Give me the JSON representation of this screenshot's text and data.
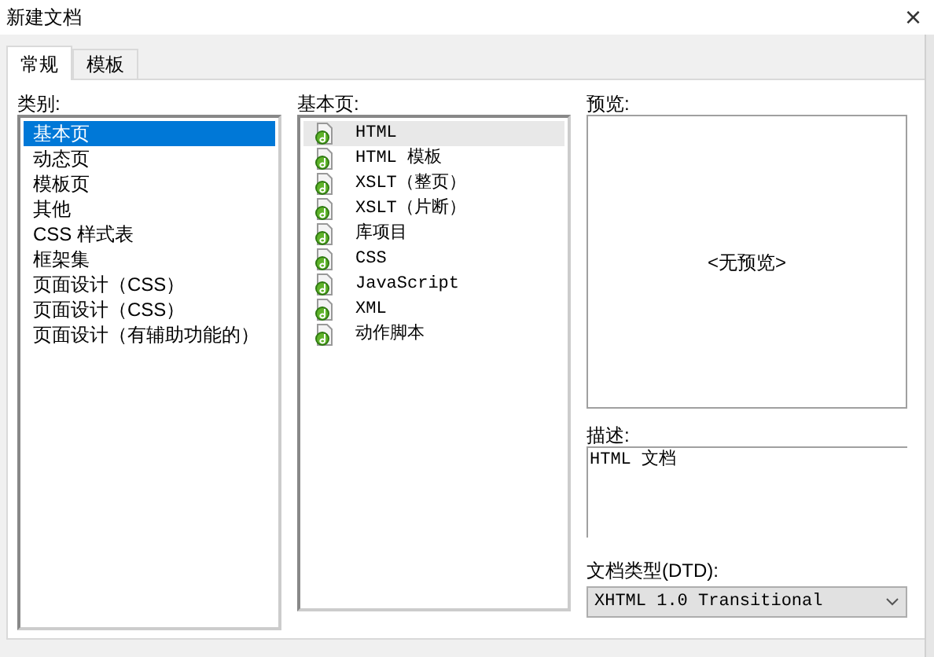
{
  "window": {
    "title": "新建文档",
    "close": "×"
  },
  "tabs": [
    {
      "label": "常规",
      "selected": true
    },
    {
      "label": "模板",
      "selected": false
    }
  ],
  "category": {
    "label": "类别:",
    "items": [
      {
        "label": "基本页",
        "selected": true
      },
      {
        "label": "动态页",
        "selected": false
      },
      {
        "label": "模板页",
        "selected": false
      },
      {
        "label": "其他",
        "selected": false
      },
      {
        "label": "CSS 样式表",
        "selected": false
      },
      {
        "label": "框架集",
        "selected": false
      },
      {
        "label": "页面设计（CSS）",
        "selected": false
      },
      {
        "label": "页面设计（CSS）",
        "selected": false
      },
      {
        "label": "页面设计（有辅助功能的）",
        "selected": false
      }
    ]
  },
  "pages": {
    "label": "基本页:",
    "items": [
      {
        "label": "HTML",
        "selected": true
      },
      {
        "label": "HTML 模板",
        "selected": false
      },
      {
        "label": "XSLT（整页）",
        "selected": false
      },
      {
        "label": "XSLT（片断）",
        "selected": false
      },
      {
        "label": "库项目",
        "selected": false
      },
      {
        "label": "CSS",
        "selected": false
      },
      {
        "label": "JavaScript",
        "selected": false
      },
      {
        "label": "XML",
        "selected": false
      },
      {
        "label": "动作脚本",
        "selected": false
      }
    ]
  },
  "preview": {
    "label": "预览:",
    "text": "<无预览>"
  },
  "description": {
    "label": "描述:",
    "text": "HTML 文档"
  },
  "doctype": {
    "label": "文档类型(DTD):",
    "value": "XHTML 1.0 Transitional"
  }
}
